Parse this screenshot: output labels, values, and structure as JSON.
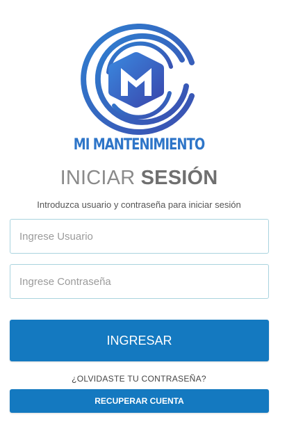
{
  "brand": {
    "name": "MI MANTENIMIENTO",
    "logo_icon": "mm-logo-icon",
    "color": "#2e75c8"
  },
  "login": {
    "title_light": "INICIAR",
    "title_bold": "SESIÓN",
    "subtitle": "Introduzca usuario y contraseña para iniciar sesión",
    "username_placeholder": "Ingrese Usuario",
    "username_value": "",
    "password_placeholder": "Ingrese Contraseña",
    "password_value": "",
    "submit_label": "INGRESAR",
    "forgot_text": "¿OLVIDASTE TU CONTRASEÑA?",
    "recover_label": "RECUPERAR CUENTA"
  },
  "colors": {
    "primary": "#1479c0",
    "title_gray": "#8a8a8a",
    "input_border": "#a9d3de"
  }
}
